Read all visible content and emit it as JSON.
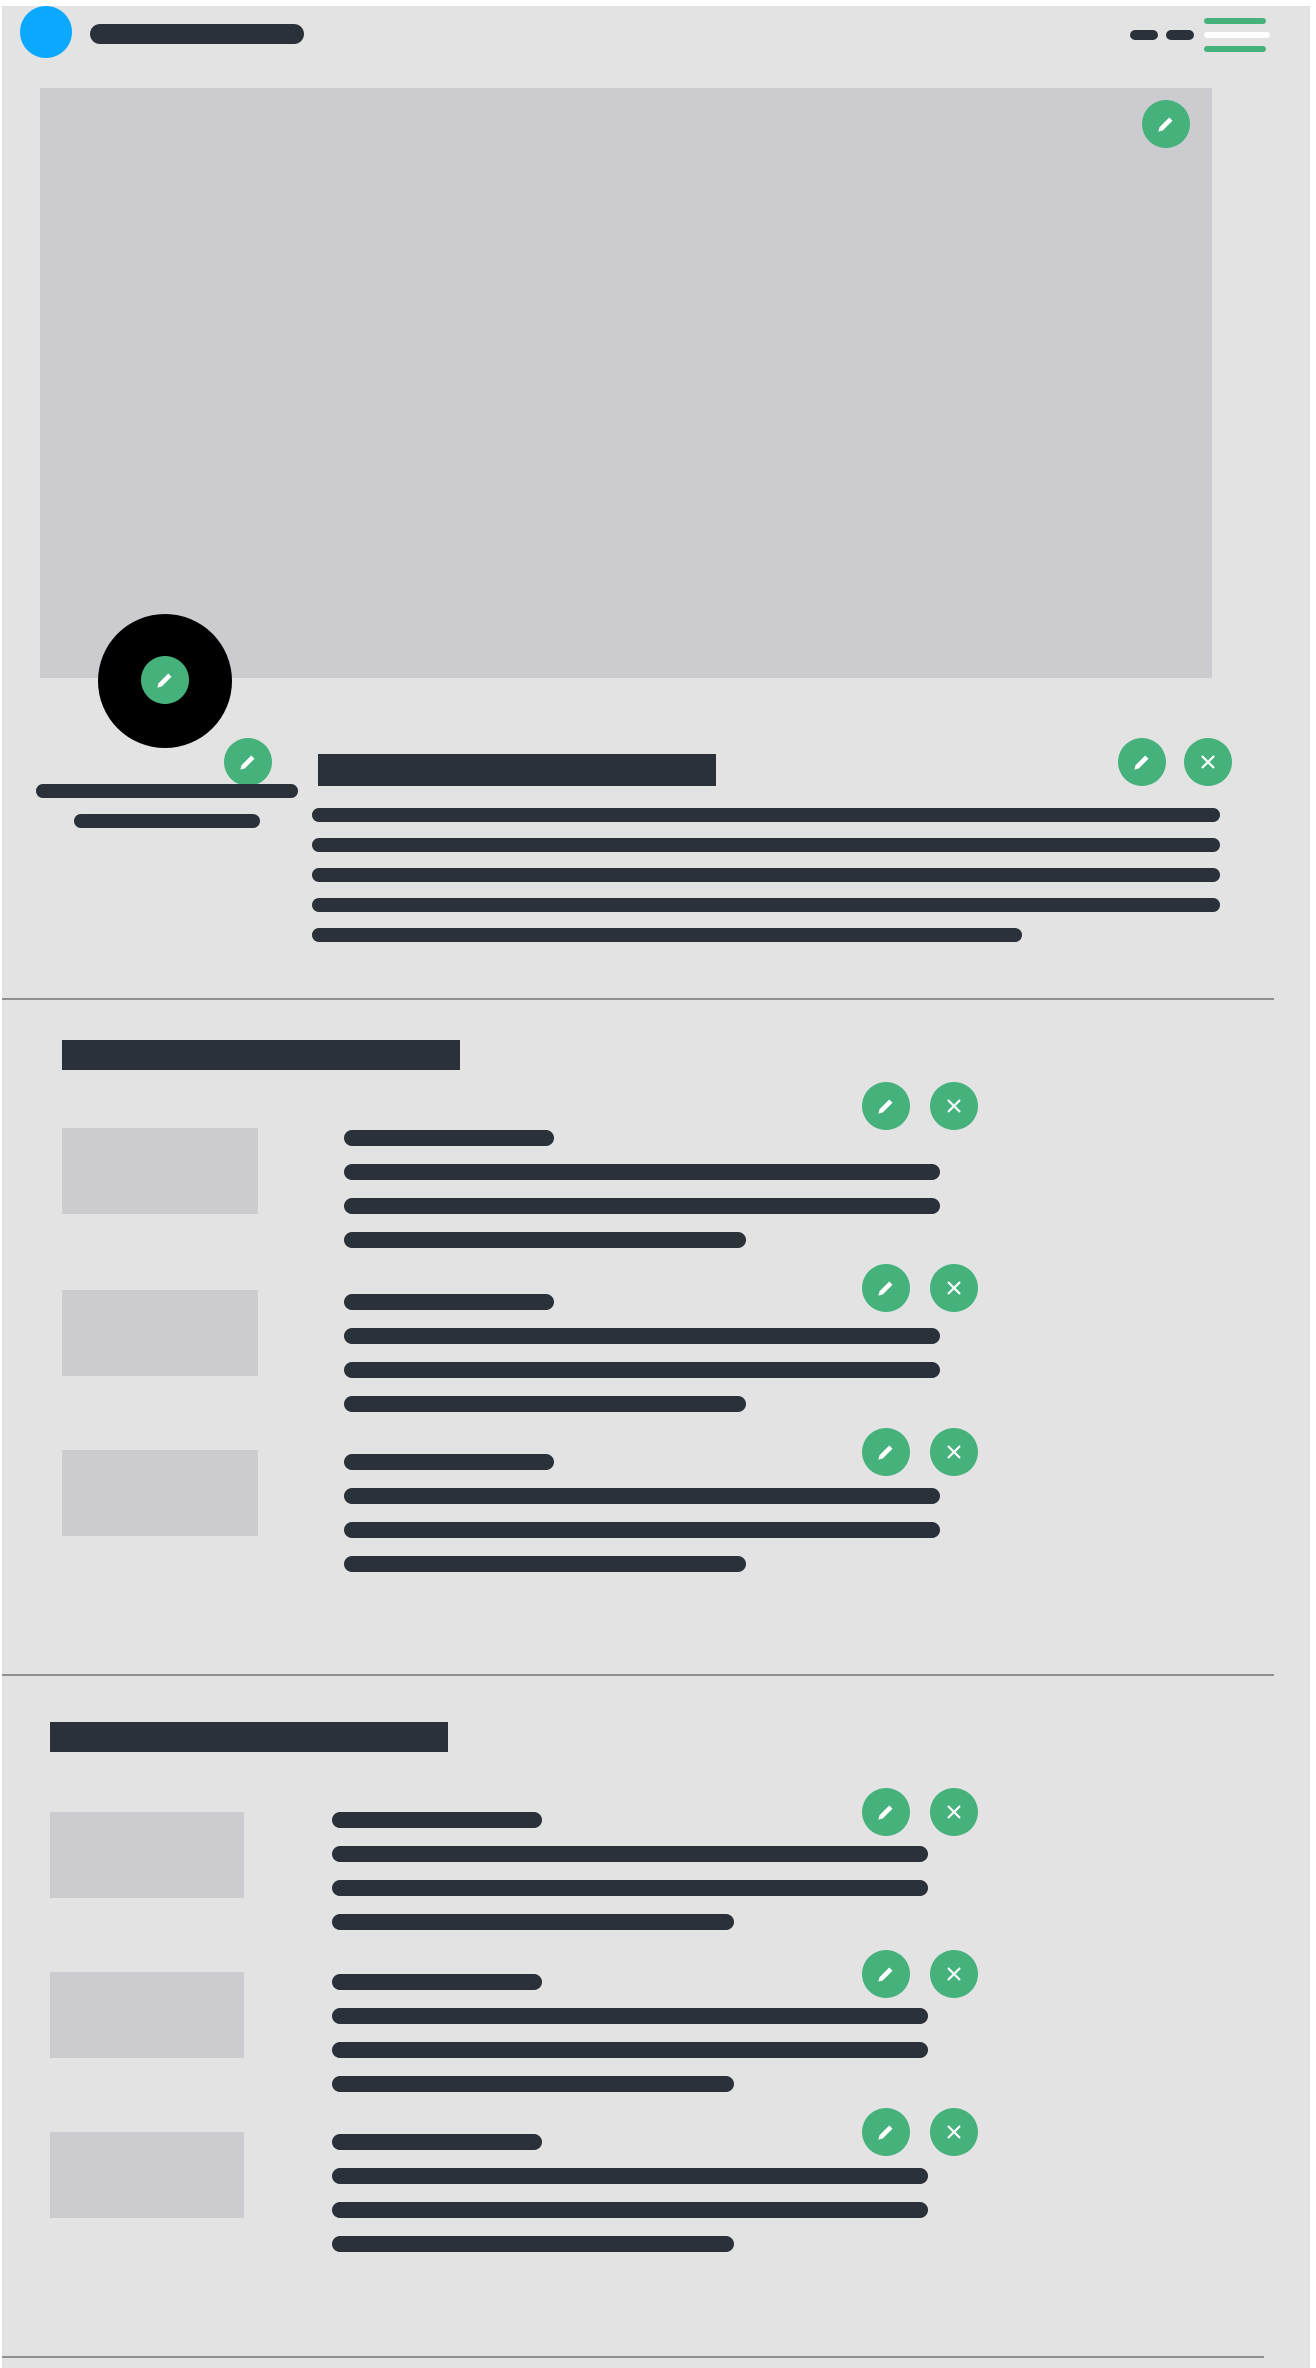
{
  "colors": {
    "page_background": "#e3e3e4",
    "text_placeholder": "#2a3139",
    "image_placeholder": "#cccbd0",
    "action_button": "#45b17b",
    "brand_dot": "#0aa9ff",
    "avatar_ring": "#000000",
    "divider": "#8e8f93"
  },
  "header": {
    "logo_icon": "circle-logo-icon",
    "menu_icon": "hamburger-menu-icon"
  },
  "profile": {
    "cover_edit_icon": "pencil-icon",
    "avatar_edit_icon": "pencil-icon",
    "info_edit_icon": "pencil-icon",
    "about_edit_icon": "pencil-icon",
    "about_delete_icon": "close-icon"
  },
  "sections": [
    {
      "items": [
        {
          "edit_icon": "pencil-icon",
          "delete_icon": "close-icon"
        },
        {
          "edit_icon": "pencil-icon",
          "delete_icon": "close-icon"
        },
        {
          "edit_icon": "pencil-icon",
          "delete_icon": "close-icon"
        }
      ]
    },
    {
      "items": [
        {
          "edit_icon": "pencil-icon",
          "delete_icon": "close-icon"
        },
        {
          "edit_icon": "pencil-icon",
          "delete_icon": "close-icon"
        },
        {
          "edit_icon": "pencil-icon",
          "delete_icon": "close-icon"
        }
      ]
    }
  ]
}
